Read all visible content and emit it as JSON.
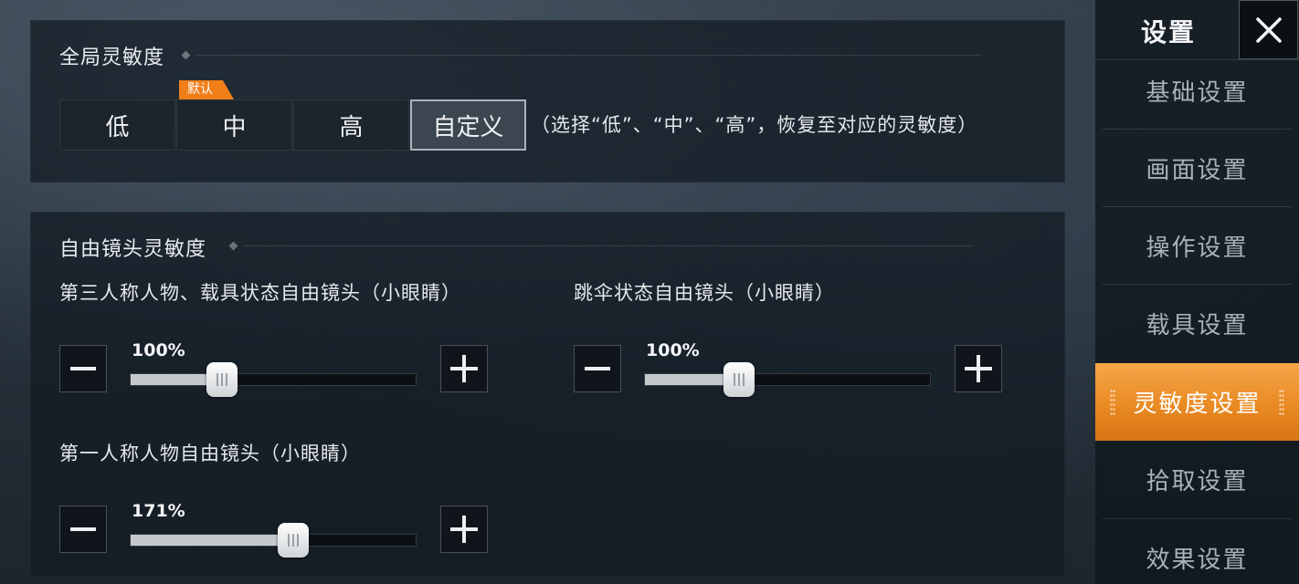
{
  "global": {
    "title": "全局灵敏度",
    "options": [
      "低",
      "中",
      "高",
      "自定义"
    ],
    "selected": "自定义",
    "default_badge": "默认",
    "default_option": "中",
    "hint": "（选择“低”、“中”、“高”，恢复至对应的灵敏度）"
  },
  "free_camera": {
    "title": "自由镜头灵敏度",
    "sliders": [
      {
        "label": "第三人称人物、载具状态自由镜头（小眼睛）",
        "value_text": "100%",
        "fraction": 0.32
      },
      {
        "label": "跳伞状态自由镜头（小眼睛）",
        "value_text": "100%",
        "fraction": 0.33
      },
      {
        "label": "第一人称人物自由镜头（小眼睛）",
        "value_text": "171%",
        "fraction": 0.57
      }
    ]
  },
  "sidebar": {
    "title": "设置",
    "close_icon": "close-icon",
    "items": [
      {
        "label": "基础设置",
        "active": false
      },
      {
        "label": "画面设置",
        "active": false
      },
      {
        "label": "操作设置",
        "active": false
      },
      {
        "label": "载具设置",
        "active": false
      },
      {
        "label": "灵敏度设置",
        "active": true
      },
      {
        "label": "拾取设置",
        "active": false
      },
      {
        "label": "效果设置",
        "active": false
      }
    ]
  },
  "colors": {
    "accent": "#f07f1a",
    "active_nav": "#e98a23",
    "panel": "#121a22"
  }
}
